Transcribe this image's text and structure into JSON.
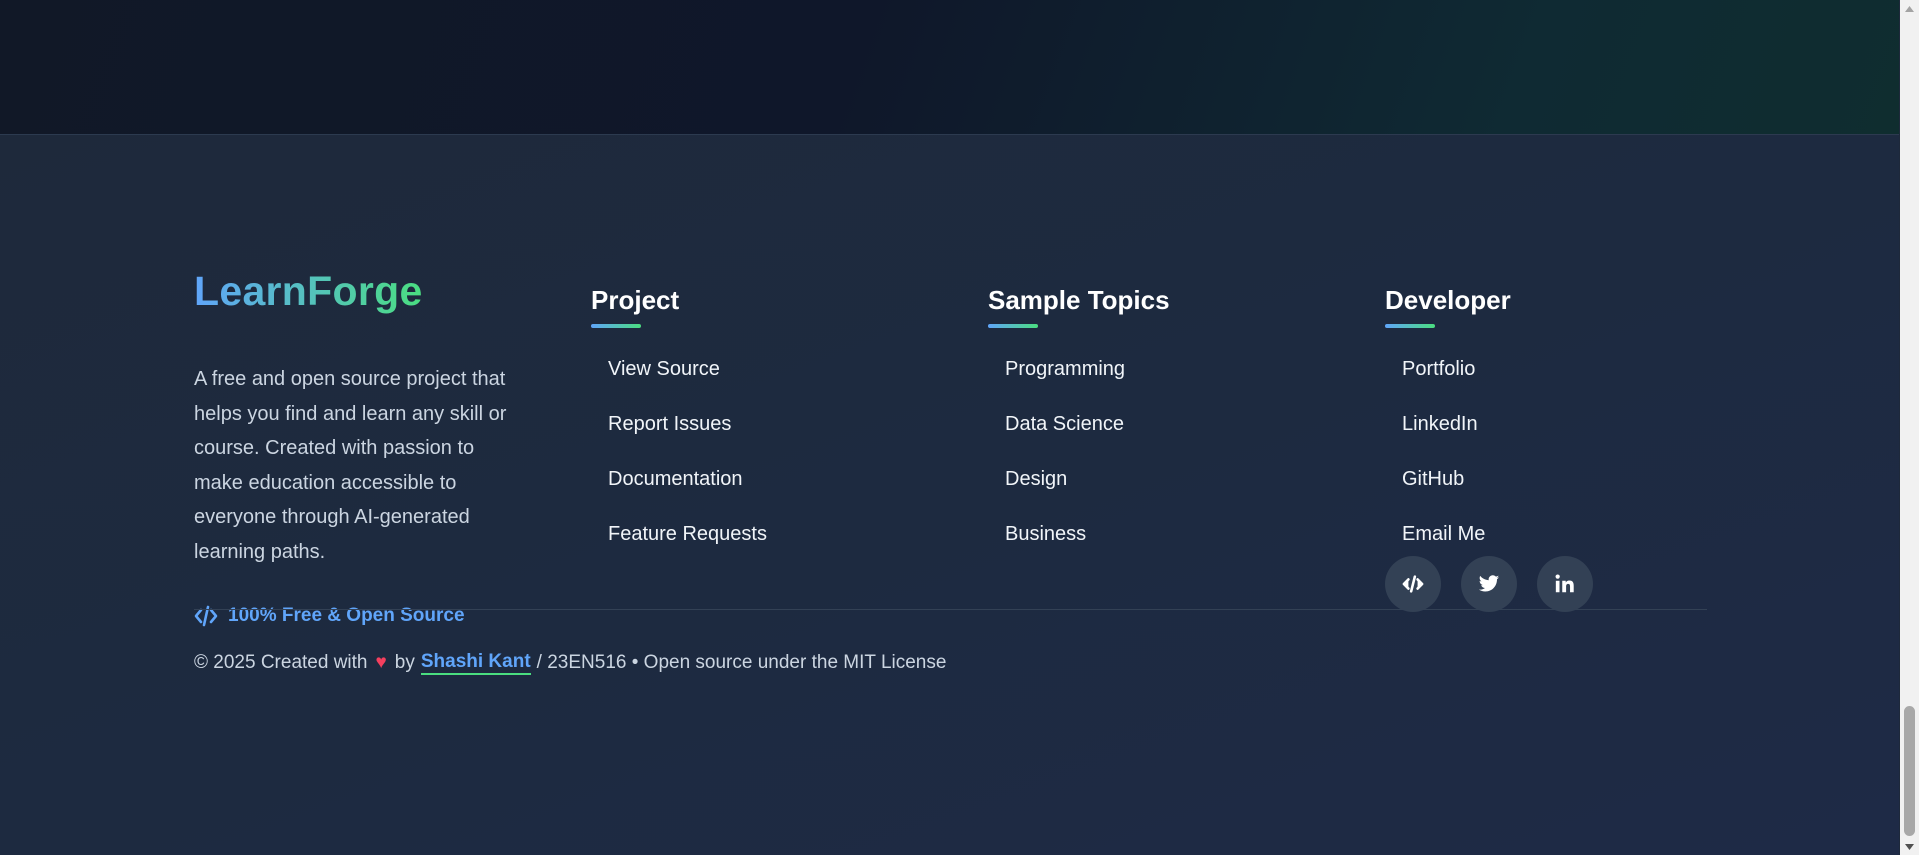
{
  "brand": {
    "name": "LearnForge",
    "description": "A free and open source project that helps you find and learn any skill or course. Created with passion to make education accessible to everyone through AI-generated learning paths.",
    "badge": "100% Free & Open Source",
    "badge_icon": "code-icon"
  },
  "columns": [
    {
      "title": "Project",
      "links": [
        "View Source",
        "Report Issues",
        "Documentation",
        "Feature Requests"
      ]
    },
    {
      "title": "Sample Topics",
      "links": [
        "Programming",
        "Data Science",
        "Design",
        "Business"
      ]
    },
    {
      "title": "Developer",
      "links": [
        "Portfolio",
        "LinkedIn",
        "GitHub",
        "Email Me"
      ]
    }
  ],
  "socials": [
    {
      "icon": "code-icon"
    },
    {
      "icon": "twitter-icon"
    },
    {
      "icon": "linkedin-icon"
    }
  ],
  "copyright": {
    "prefix": "© 2025 Created with",
    "heart": "♥",
    "by": "by",
    "author": "Shashi Kant",
    "suffix": "/ 23EN516 • Open source under the MIT License"
  },
  "colors": {
    "accent_blue": "#60a5fa",
    "accent_green": "#4ade80",
    "footer_bg": "#1e293b",
    "heart": "#f43f5e"
  }
}
